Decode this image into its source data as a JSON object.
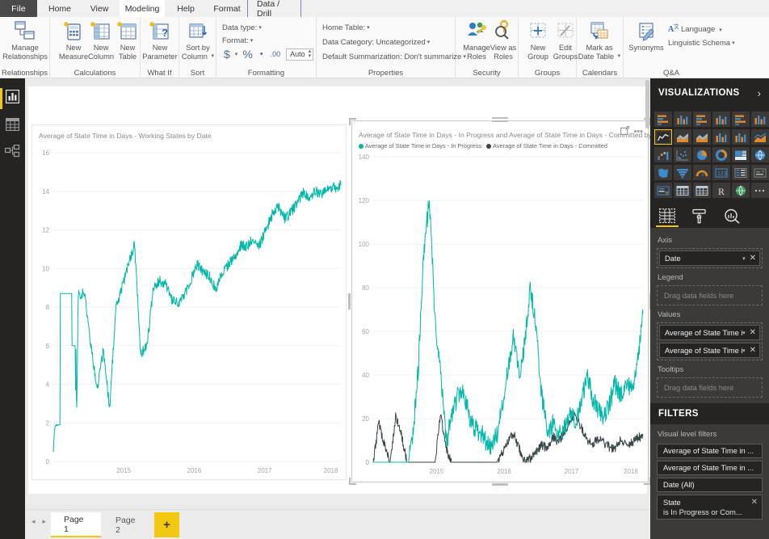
{
  "ribbon": {
    "file_label": "File",
    "tabs": [
      {
        "label": "Home",
        "active": false
      },
      {
        "label": "View",
        "active": false
      },
      {
        "label": "Modeling",
        "active": true
      },
      {
        "label": "Help",
        "active": false
      },
      {
        "label": "Format",
        "active": false
      },
      {
        "label": "Data / Drill",
        "active": false
      }
    ],
    "groups": [
      {
        "name": "Relationships",
        "buttons": [
          {
            "label": "Manage\nRelationships",
            "icon": "manage-relationships-icon"
          }
        ]
      },
      {
        "name": "Calculations",
        "buttons": [
          {
            "label": "New\nMeasure",
            "icon": "new-measure-icon"
          },
          {
            "label": "New\nColumn",
            "icon": "new-column-icon"
          },
          {
            "label": "New\nTable",
            "icon": "new-table-icon"
          }
        ]
      },
      {
        "name": "What If",
        "buttons": [
          {
            "label": "New\nParameter",
            "icon": "new-parameter-icon"
          }
        ]
      },
      {
        "name": "Sort",
        "buttons": [
          {
            "label": "Sort by\nColumn",
            "icon": "sort-by-column-icon",
            "caret": true
          }
        ]
      },
      {
        "name": "Formatting",
        "rows": [
          {
            "label": "Data type:",
            "caret": true
          },
          {
            "label": "Format:",
            "caret": true
          }
        ],
        "currency_symbol": "$",
        "percent_symbol": "%",
        "thousands_symbol": "•",
        "decimal_symbol": ".00",
        "auto_value": "Auto"
      },
      {
        "name": "Properties",
        "rows": [
          {
            "label": "Home Table:",
            "caret": true
          },
          {
            "label": "Data Category: Uncategorized",
            "caret": true
          },
          {
            "label": "Default Summarization: Don't summarize",
            "caret": true
          }
        ]
      },
      {
        "name": "Security",
        "buttons": [
          {
            "label": "Manage\nRoles",
            "icon": "manage-roles-icon"
          },
          {
            "label": "View as\nRoles",
            "icon": "view-as-roles-icon"
          }
        ]
      },
      {
        "name": "Groups",
        "buttons": [
          {
            "label": "New\nGroup",
            "icon": "new-group-icon"
          },
          {
            "label": "Edit\nGroups",
            "icon": "edit-groups-icon"
          }
        ]
      },
      {
        "name": "Calendars",
        "buttons": [
          {
            "label": "Mark as\nDate Table",
            "icon": "mark-as-date-table-icon",
            "caret": true
          }
        ]
      },
      {
        "name": "Q&A",
        "buttons": [
          {
            "label": "Synonyms",
            "icon": "synonyms-icon"
          }
        ],
        "rows": [
          {
            "label": "Language",
            "caret": true,
            "icon": "language-icon"
          },
          {
            "label": "Linguistic Schema",
            "caret": true
          }
        ]
      }
    ]
  },
  "rail": {
    "items": [
      {
        "name": "report-view",
        "icon": "report-bar-chart-icon",
        "selected": true
      },
      {
        "name": "data-view",
        "icon": "data-table-icon",
        "selected": false
      },
      {
        "name": "model-view",
        "icon": "model-relationships-icon",
        "selected": false
      }
    ]
  },
  "chart_data": [
    {
      "type": "line",
      "id": "left-chart",
      "title": "Average of State Time in Days - Working States by Date",
      "xlabel": "",
      "ylabel": "",
      "ylim": [
        0,
        16
      ],
      "yticks": [
        0,
        2,
        4,
        6,
        8,
        10,
        12,
        14,
        16
      ],
      "xticks": [
        "2015",
        "2016",
        "2017",
        "2018"
      ],
      "grid": true,
      "legend": null,
      "series": [
        {
          "name": "Average of State Time in Days - Working States",
          "color": "#01b8aa",
          "x": [
            "2014-06",
            "2014-07",
            "2014-08",
            "2014-09",
            "2014-10",
            "2014-11",
            "2014-12",
            "2015-01",
            "2015-02",
            "2015-03",
            "2015-04",
            "2015-05",
            "2015-06",
            "2015-07",
            "2015-08",
            "2015-09",
            "2015-10",
            "2015-11",
            "2015-12",
            "2016-01",
            "2016-02",
            "2016-03",
            "2016-04",
            "2016-05",
            "2016-06",
            "2016-07",
            "2016-08",
            "2016-09",
            "2016-10",
            "2016-11",
            "2016-12",
            "2017-01",
            "2017-02",
            "2017-03",
            "2017-04",
            "2017-05",
            "2017-06",
            "2017-07",
            "2017-08",
            "2017-09",
            "2017-10",
            "2017-11",
            "2017-12",
            "2018-01",
            "2018-02",
            "2018-03",
            "2018-04"
          ],
          "values": [
            0.5,
            1.6,
            1.8,
            8.7,
            8.7,
            8.7,
            6.0,
            3.7,
            5.8,
            2.8,
            7.9,
            9.0,
            10.2,
            11.3,
            5.5,
            6.1,
            8.9,
            9.4,
            9.2,
            8.3,
            8.2,
            8.6,
            9.4,
            10.2,
            9.8,
            9.6,
            8.9,
            9.8,
            10.2,
            10.6,
            11.2,
            11.1,
            11.6,
            11.2,
            12.0,
            12.8,
            13.2,
            12.6,
            12.9,
            13.4,
            13.9,
            13.7,
            14.0,
            13.9,
            14.1,
            14.2,
            14.3
          ]
        }
      ]
    },
    {
      "type": "line",
      "id": "right-chart",
      "title": "Average of State Time in Days - In Progress and Average of State Time in Days - Committed by Date",
      "xlabel": "",
      "ylabel": "",
      "ylim": [
        0,
        140
      ],
      "yticks": [
        0,
        20,
        40,
        60,
        80,
        100,
        120,
        140
      ],
      "xticks": [
        "2015",
        "2016",
        "2017",
        "2018"
      ],
      "grid": true,
      "legend_position": "top",
      "series": [
        {
          "name": "Average of State Time in Days - In Progress",
          "color": "#01b8aa",
          "values": [
            0,
            0,
            0,
            0,
            0,
            0,
            0,
            10,
            42,
            97,
            120,
            66,
            42,
            8,
            22,
            30,
            34,
            22,
            16,
            14,
            10,
            8,
            12,
            26,
            44,
            59,
            40,
            55,
            80,
            60,
            30,
            14,
            18,
            12,
            16,
            22,
            18,
            26,
            40,
            30,
            24,
            20,
            26,
            36,
            30,
            38,
            32,
            46,
            68
          ]
        },
        {
          "name": "Average of State Time in Days - Committed",
          "color": "#374649",
          "values": [
            0,
            18,
            8,
            0,
            21,
            13,
            0,
            0,
            0,
            0,
            0,
            0,
            22,
            6,
            0,
            0,
            0,
            0,
            0,
            0,
            0,
            0,
            0,
            4,
            10,
            13,
            6,
            0,
            2,
            5,
            8,
            6,
            12,
            9,
            14,
            18,
            22,
            16,
            10,
            8,
            11,
            9,
            7,
            6,
            10,
            8,
            9,
            11,
            12
          ]
        }
      ]
    }
  ],
  "visualizations_pane": {
    "title": "VISUALIZATIONS",
    "collapse_icon": "chevron-right-icon",
    "gallery": [
      {
        "name": "stacked-bar-chart",
        "selected": false
      },
      {
        "name": "stacked-column-chart",
        "selected": false
      },
      {
        "name": "clustered-bar-chart",
        "selected": false
      },
      {
        "name": "clustered-column-chart",
        "selected": false
      },
      {
        "name": "100-stacked-bar-chart",
        "selected": false
      },
      {
        "name": "100-stacked-column-chart",
        "selected": false
      },
      {
        "name": "line-chart",
        "selected": true
      },
      {
        "name": "area-chart",
        "selected": false
      },
      {
        "name": "stacked-area-chart",
        "selected": false
      },
      {
        "name": "line-and-stacked-column-chart",
        "selected": false
      },
      {
        "name": "line-and-clustered-column-chart",
        "selected": false
      },
      {
        "name": "ribbon-chart",
        "selected": false
      },
      {
        "name": "waterfall-chart",
        "selected": false
      },
      {
        "name": "scatter-chart",
        "selected": false
      },
      {
        "name": "pie-chart",
        "selected": false
      },
      {
        "name": "donut-chart",
        "selected": false
      },
      {
        "name": "treemap",
        "selected": false
      },
      {
        "name": "map",
        "selected": false
      },
      {
        "name": "filled-map",
        "selected": false
      },
      {
        "name": "funnel-chart",
        "selected": false
      },
      {
        "name": "gauge",
        "selected": false
      },
      {
        "name": "card",
        "selected": false
      },
      {
        "name": "multi-row-card",
        "selected": false
      },
      {
        "name": "kpi",
        "selected": false
      },
      {
        "name": "slicer",
        "selected": false
      },
      {
        "name": "table",
        "selected": false
      },
      {
        "name": "matrix",
        "selected": false
      },
      {
        "name": "r-script-visual",
        "selected": false
      },
      {
        "name": "arcgis-map",
        "selected": false
      },
      {
        "name": "more-visuals",
        "selected": false
      }
    ],
    "tabs": [
      {
        "name": "fields-tab",
        "icon": "fields-grid-icon",
        "selected": true
      },
      {
        "name": "format-tab",
        "icon": "paint-roller-icon",
        "selected": false
      },
      {
        "name": "analytics-tab",
        "icon": "magnifier-chart-icon",
        "selected": false
      }
    ],
    "wells": [
      {
        "label": "Axis",
        "chips": [
          {
            "text": "Date",
            "dropdown": true,
            "remove": true
          }
        ],
        "placeholder": null
      },
      {
        "label": "Legend",
        "chips": [],
        "placeholder": "Drag data fields here"
      },
      {
        "label": "Values",
        "chips": [
          {
            "text": "Average of State Time in",
            "dropdown": true,
            "remove": true
          },
          {
            "text": "Average of State Time in",
            "dropdown": true,
            "remove": true
          }
        ],
        "placeholder": null
      },
      {
        "label": "Tooltips",
        "chips": [],
        "placeholder": "Drag data fields here"
      }
    ]
  },
  "filters_pane": {
    "title": "FILTERS",
    "section_label": "Visual level filters",
    "cards": [
      {
        "text": "Average of State Time in ...",
        "sub": null,
        "remove": false
      },
      {
        "text": "Average of State Time in ...",
        "sub": null,
        "remove": false
      },
      {
        "text": "Date  (All)",
        "sub": null,
        "remove": false
      },
      {
        "text": "State",
        "sub": "is In Progress or Com...",
        "remove": true
      }
    ]
  },
  "statusbar": {
    "nav_prev": "◂",
    "nav_next": "▸",
    "pages": [
      {
        "label": "Page 1",
        "active": true
      },
      {
        "label": "Page 2",
        "active": false
      }
    ],
    "add_page_label": "+"
  },
  "visual_header_icons": [
    {
      "name": "focus-mode-icon"
    },
    {
      "name": "more-options-icon",
      "glyph": "•••"
    }
  ],
  "colors": {
    "accent_yellow": "#f2c811",
    "teal": "#01b8aa",
    "dark_slate": "#374649",
    "pane_bg": "#3b3a39",
    "pane_header_bg": "#252423"
  }
}
